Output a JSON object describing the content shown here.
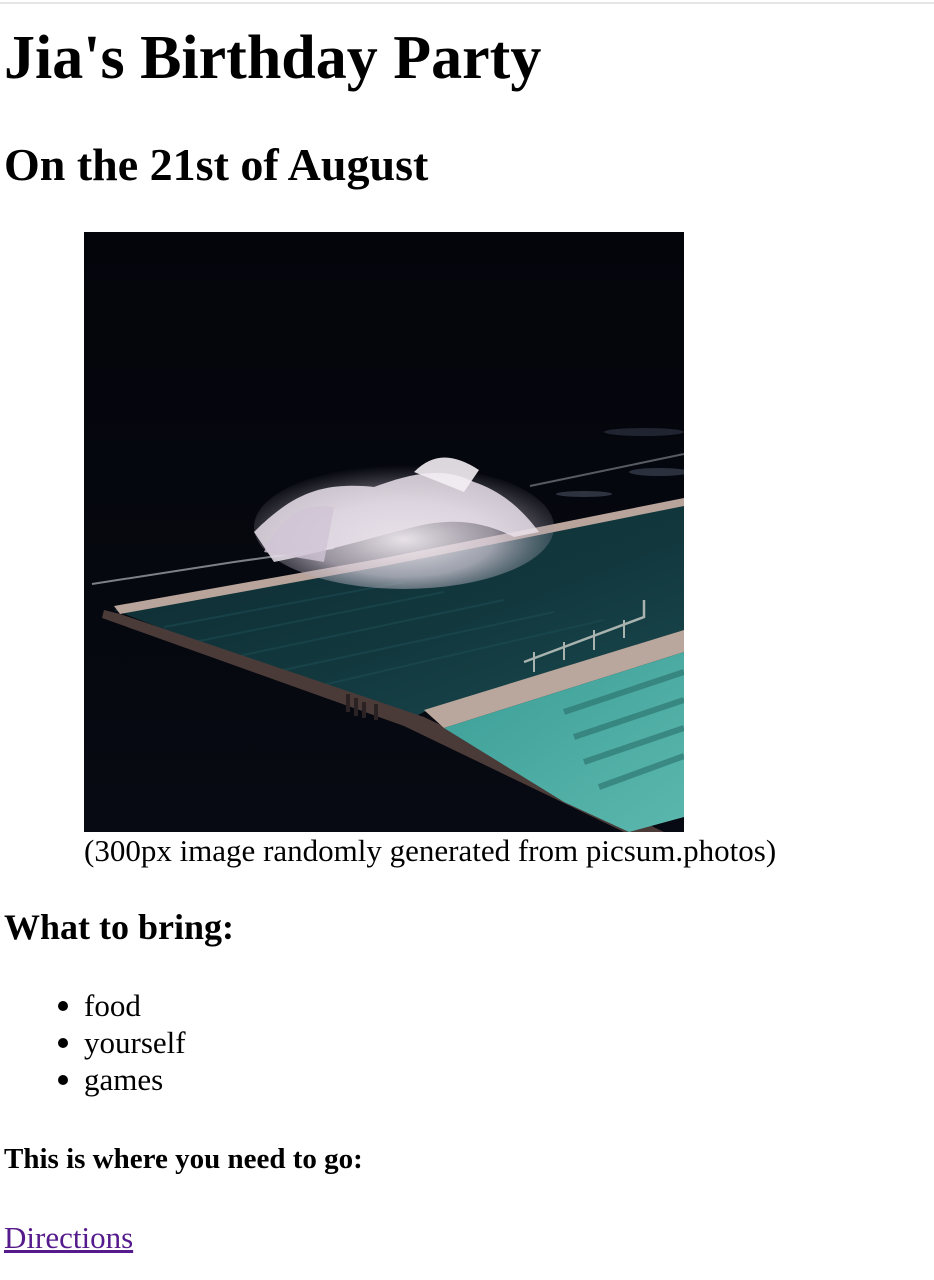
{
  "page": {
    "title": "Jia's Birthday Party",
    "date_heading": "On the 21st of August"
  },
  "figure": {
    "image_description": "Ocean pool at night with a wave crashing over the edge",
    "caption": "(300px image randomly generated from picsum.photos)"
  },
  "bring": {
    "heading": "What to bring:",
    "items": [
      "food",
      "yourself",
      "games"
    ]
  },
  "location": {
    "heading": "This is where you need to go:",
    "link_label": "Directions"
  },
  "colors": {
    "visited_link": "#551a8b",
    "text": "#000000",
    "background": "#ffffff"
  },
  "icons": {
    "bullet": "bullet-disc-icon"
  }
}
